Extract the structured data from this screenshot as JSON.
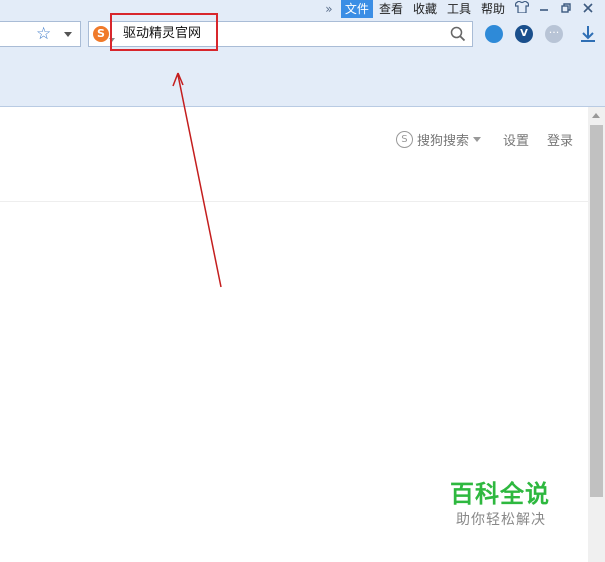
{
  "menubar": {
    "more": "»",
    "items": [
      "文件",
      "查看",
      "收藏",
      "工具",
      "帮助"
    ],
    "active_index": 0
  },
  "address_bar": {
    "value": "驱动精灵官网",
    "engine_logo": "S"
  },
  "toolbar_icons": [
    "bird-icon",
    "v-shield-icon",
    "more-dots-icon",
    "download-icon"
  ],
  "page": {
    "search_engine": "搜狗搜索",
    "settings": "设置",
    "login": "登录"
  },
  "watermark": {
    "title": "百科全说",
    "subtitle": "助你轻松解决"
  },
  "colors": {
    "highlight": "#d8262c",
    "arrow": "#c41e1e",
    "chrome": "#e3ecf8",
    "active_menu": "#3b8ee5",
    "watermark": "#2eb83f"
  }
}
